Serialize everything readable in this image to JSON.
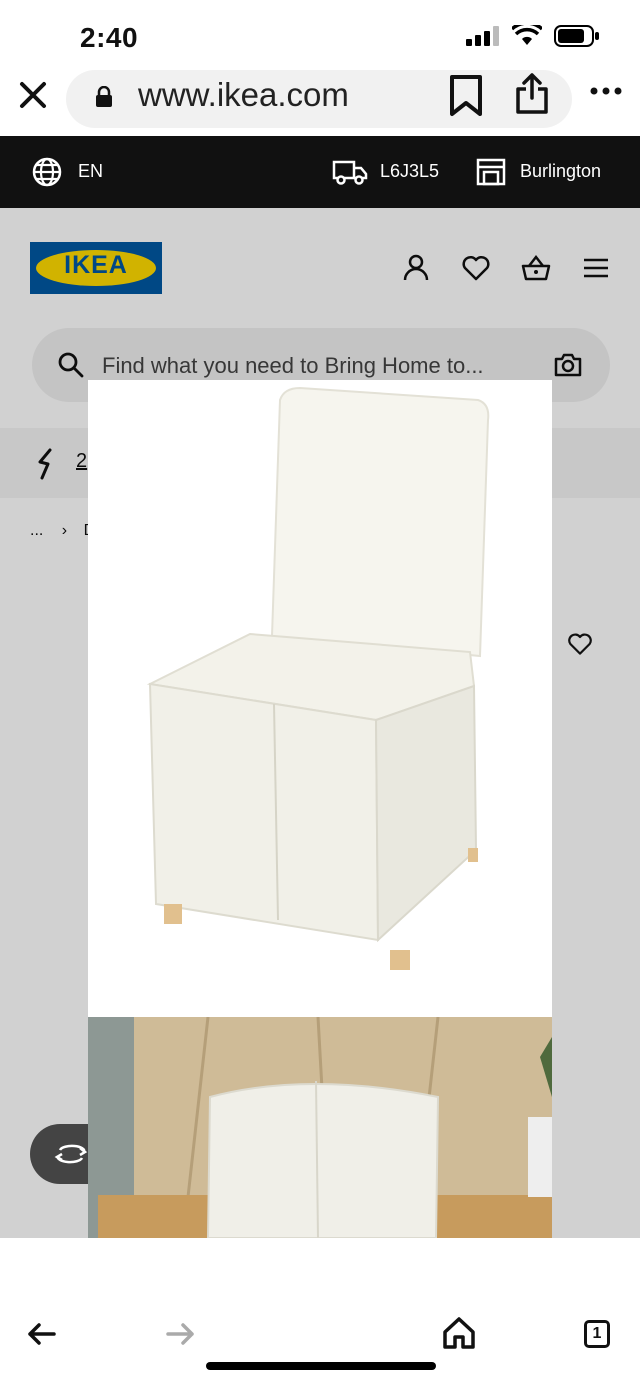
{
  "status": {
    "time": "2:40"
  },
  "browser": {
    "url": "www.ikea.com"
  },
  "locale_bar": {
    "language": "EN",
    "postal_code": "L6J3L5",
    "store": "Burlington"
  },
  "header": {
    "logo_text": "IKEA"
  },
  "search": {
    "placeholder": "Find what you need to Bring Home to..."
  },
  "promo": {
    "text_partial": "2"
  },
  "breadcrumb": {
    "ellipsis": "...",
    "separator": "›",
    "current_partial": "D"
  },
  "viewer": {
    "image_1": "white chair cover product photo",
    "image_2": "chair in room lifestyle photo"
  },
  "toolbar": {
    "tab_count": "1"
  },
  "colors": {
    "ikea_blue": "#0058a3",
    "ikea_yellow": "#ffdb00",
    "locale_bar_bg": "#111111"
  }
}
